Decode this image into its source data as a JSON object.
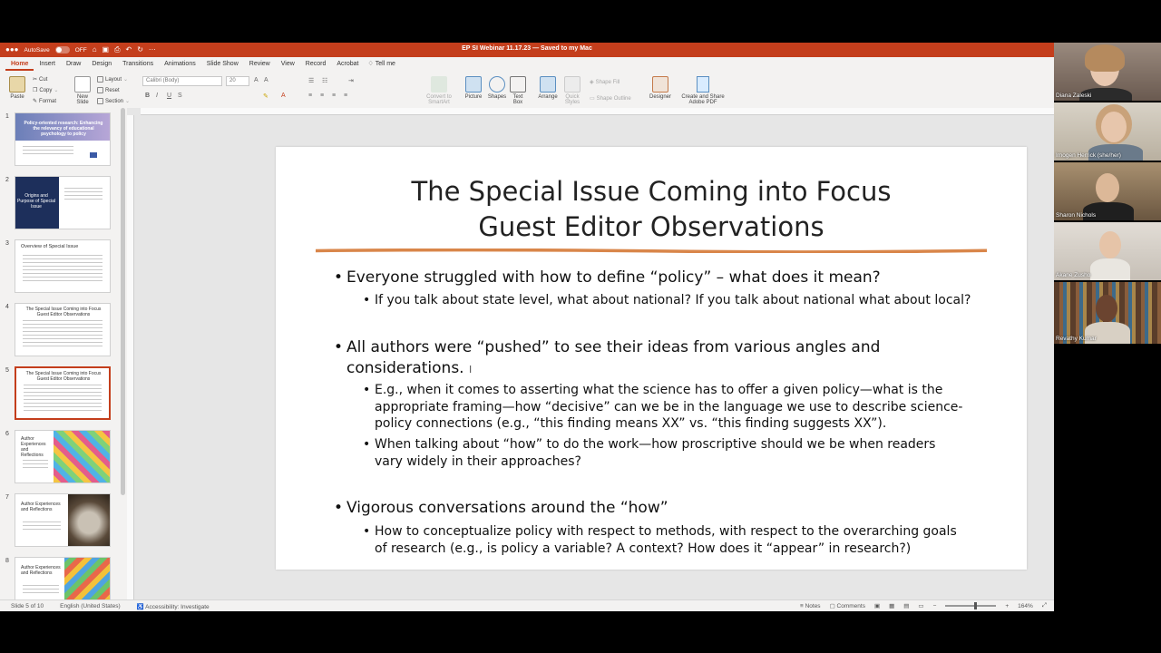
{
  "titlebar": {
    "autosave": "AutoSave",
    "autosave_state": "OFF",
    "document_title": "EP SI Webinar 11.17.23 — Saved to my Mac"
  },
  "menu": [
    "Home",
    "Insert",
    "Draw",
    "Design",
    "Transitions",
    "Animations",
    "Slide Show",
    "Review",
    "View",
    "Record",
    "Acrobat",
    "Tell me"
  ],
  "ribbon": {
    "paste": "Paste",
    "cut": "Cut",
    "copy": "Copy",
    "format": "Format",
    "new_slide_1": "New",
    "new_slide_2": "Slide",
    "layout": "Layout",
    "reset": "Reset",
    "section": "Section",
    "font_name": "Calibri (Body)",
    "font_size": "20",
    "convert_smartart_1": "Convert to",
    "convert_smartart_2": "SmartArt",
    "picture": "Picture",
    "shapes": "Shapes",
    "text_box_1": "Text",
    "text_box_2": "Box",
    "arrange": "Arrange",
    "quick_styles_1": "Quick",
    "quick_styles_2": "Styles",
    "shape_fill": "Shape Fill",
    "shape_outline": "Shape Outline",
    "designer": "Designer",
    "adobe_1": "Create and Share",
    "adobe_2": "Adobe PDF"
  },
  "thumbnails": [
    {
      "num": "1",
      "title": "Policy-oriented research: Enhancing the relevancy of educational psychology to policy"
    },
    {
      "num": "2",
      "title": "Origins and Purpose of Special Issue"
    },
    {
      "num": "3",
      "title": "Overview of Special Issue"
    },
    {
      "num": "4",
      "title": "The Special Issue Coming into Focus Guest Editor Observations"
    },
    {
      "num": "5",
      "title": "The Special Issue Coming into Focus Guest Editor Observations"
    },
    {
      "num": "6",
      "title": "Author Experiences and Reflections"
    },
    {
      "num": "7",
      "title": "Author Experiences and Reflections"
    },
    {
      "num": "8",
      "title": "Author Experiences and Reflections"
    }
  ],
  "slide": {
    "title_line1": "The Special Issue Coming into Focus",
    "title_line2": "Guest Editor Observations",
    "bullet1": "Everyone struggled with how to define “policy” – what does it mean?",
    "bullet1_sub1": "If you talk about state level, what about national? If you talk about national what about local?",
    "bullet2_line1": "All authors were “pushed” to see their ideas from various angles and",
    "bullet2_line2": "considerations.",
    "bullet2_sub1_line1": "E.g., when it comes to asserting what the science has to offer a given policy—what is the",
    "bullet2_sub1_line2": "appropriate framing—how “decisive” can we be in the language we use to describe science-",
    "bullet2_sub1_line3": "policy connections (e.g., “this finding means XX” vs. “this finding suggests XX”).",
    "bullet2_sub2_line1": "When talking about “how” to do the work—how proscriptive should we be when readers",
    "bullet2_sub2_line2": "vary widely in their approaches?",
    "bullet3": "Vigorous conversations around the “how”",
    "bullet3_sub1_line1": "How to conceptualize policy with respect to methods, with respect to the overarching goals",
    "bullet3_sub1_line2": "of research (e.g., is policy a variable? A context? How does it “appear” in research?)"
  },
  "status": {
    "slide_of": "Slide 5 of 10",
    "language": "English (United States)",
    "accessibility": "Accessibility: Investigate",
    "notes": "Notes",
    "comments": "Comments",
    "zoom": "164%"
  },
  "participants": [
    "Diana Zaleski",
    "Imogen Herrick (she/her)",
    "Sharon Nichols",
    "Akane Zusho",
    "Revathy Kumar"
  ],
  "colors": {
    "accent": "#c43e1c",
    "title_rule": "#d9864a"
  }
}
